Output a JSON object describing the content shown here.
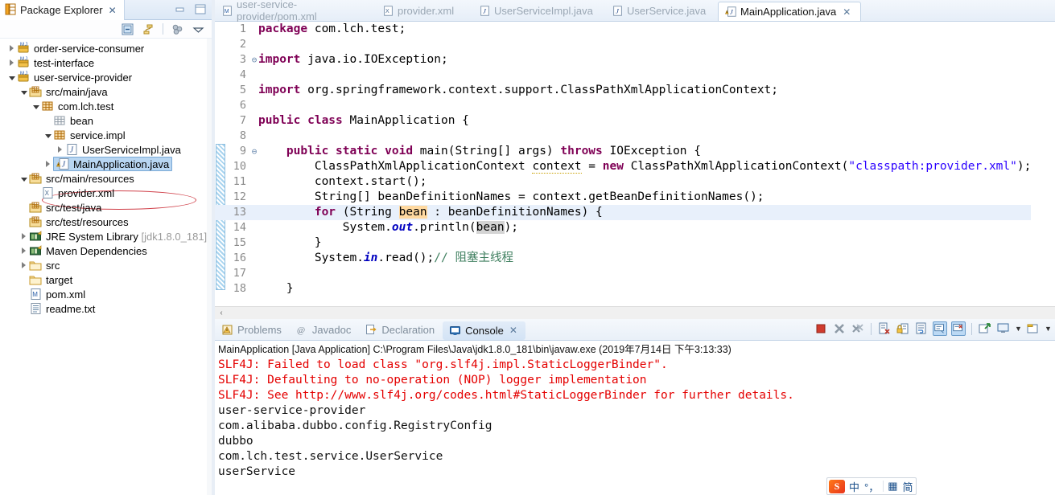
{
  "package_explorer": {
    "tab_title": "Package Explorer",
    "tab_close": "✕",
    "toolbar_icons": [
      "collapse-all-icon",
      "link-with-editor-icon",
      "view-menu-icon",
      "view-dropdown-icon"
    ],
    "window_buttons": [
      "minimize-icon",
      "maximize-icon"
    ],
    "tree": [
      {
        "label": "order-service-consumer",
        "indent": 0,
        "arrow": "closed",
        "icon": "maven-project-icon"
      },
      {
        "label": "test-interface",
        "indent": 0,
        "arrow": "closed",
        "icon": "maven-project-icon"
      },
      {
        "label": "user-service-provider",
        "indent": 0,
        "arrow": "open",
        "icon": "maven-project-icon"
      },
      {
        "label": "src/main/java",
        "indent": 1,
        "arrow": "open",
        "icon": "source-folder-icon"
      },
      {
        "label": "com.lch.test",
        "indent": 2,
        "arrow": "open",
        "icon": "package-icon"
      },
      {
        "label": "bean",
        "indent": 3,
        "arrow": "none",
        "icon": "empty-package-icon"
      },
      {
        "label": "service.impl",
        "indent": 3,
        "arrow": "open",
        "icon": "package-icon"
      },
      {
        "label": "UserServiceImpl.java",
        "indent": 4,
        "arrow": "closed",
        "icon": "java-file-icon"
      },
      {
        "label": "MainApplication.java",
        "indent": 3,
        "arrow": "closed",
        "icon": "java-file-warning-icon",
        "selected": true
      },
      {
        "label": "src/main/resources",
        "indent": 1,
        "arrow": "open",
        "icon": "source-folder-icon"
      },
      {
        "label": "provider.xml",
        "indent": 2,
        "arrow": "none",
        "icon": "xml-file-icon"
      },
      {
        "label": "src/test/java",
        "indent": 1,
        "arrow": "none",
        "icon": "source-folder-icon"
      },
      {
        "label": "src/test/resources",
        "indent": 1,
        "arrow": "none",
        "icon": "source-folder-icon"
      },
      {
        "label": "JRE System Library ",
        "muted": "[jdk1.8.0_181]",
        "indent": 1,
        "arrow": "closed",
        "icon": "library-icon"
      },
      {
        "label": "Maven Dependencies",
        "indent": 1,
        "arrow": "closed",
        "icon": "library-icon"
      },
      {
        "label": "src",
        "indent": 1,
        "arrow": "closed",
        "icon": "folder-icon"
      },
      {
        "label": "target",
        "indent": 1,
        "arrow": "none",
        "icon": "folder-icon"
      },
      {
        "label": "pom.xml",
        "indent": 1,
        "arrow": "none",
        "icon": "pom-file-icon"
      },
      {
        "label": "readme.txt",
        "indent": 1,
        "arrow": "none",
        "icon": "text-file-icon"
      }
    ]
  },
  "editor": {
    "tabs": [
      {
        "label": "user-service-provider/pom.xml",
        "icon": "pom-file-icon",
        "active": false
      },
      {
        "label": "provider.xml",
        "icon": "xml-file-icon",
        "active": false
      },
      {
        "label": "UserServiceImpl.java",
        "icon": "java-file-icon",
        "active": false
      },
      {
        "label": "UserService.java",
        "icon": "java-file-icon",
        "active": false
      },
      {
        "label": "MainApplication.java",
        "icon": "java-file-warning-icon",
        "active": true,
        "close": "✕"
      }
    ],
    "code_lines": [
      {
        "n": "1",
        "fold": "",
        "highlight": false
      },
      {
        "n": "2",
        "fold": "",
        "highlight": false
      },
      {
        "n": "3",
        "fold": "⊖",
        "highlight": false
      },
      {
        "n": "4",
        "fold": "",
        "highlight": false
      },
      {
        "n": "5",
        "fold": "",
        "highlight": false
      },
      {
        "n": "6",
        "fold": "",
        "highlight": false
      },
      {
        "n": "7",
        "fold": "",
        "highlight": false
      },
      {
        "n": "8",
        "fold": "",
        "highlight": false
      },
      {
        "n": "9",
        "fold": "⊖",
        "highlight": false
      },
      {
        "n": "10",
        "fold": "",
        "highlight": false
      },
      {
        "n": "11",
        "fold": "",
        "highlight": false
      },
      {
        "n": "12",
        "fold": "",
        "highlight": false
      },
      {
        "n": "13",
        "fold": "",
        "highlight": true
      },
      {
        "n": "14",
        "fold": "",
        "highlight": false
      },
      {
        "n": "15",
        "fold": "",
        "highlight": false
      },
      {
        "n": "16",
        "fold": "",
        "highlight": false
      },
      {
        "n": "17",
        "fold": "",
        "highlight": false
      },
      {
        "n": "18",
        "fold": "",
        "highlight": false
      }
    ],
    "code_text": {
      "l1": "package com.lch.test;",
      "l3": "import java.io.IOException;",
      "l5": "import org.springframework.context.support.ClassPathXmlApplicationContext;",
      "l7": "public class MainApplication {",
      "l9": "    public static void main(String[] args) throws IOException {",
      "l10": "        ClassPathXmlApplicationContext context = new ClassPathXmlApplicationContext(\"classpath:provider.xml\");",
      "l11": "        context.start();",
      "l12": "        String[] beanDefinitionNames = context.getBeanDefinitionNames();",
      "l13": "        for (String bean : beanDefinitionNames) {",
      "l14": "            System.out.println(bean);",
      "l15": "        }",
      "l16": "        System.in.read();// 阻塞主线程",
      "l18": "    }",
      "string_literal": "\"classpath:provider.xml\"",
      "comment": "// 阻塞主线程"
    }
  },
  "console": {
    "tabs": [
      {
        "label": "Problems",
        "icon": "problems-icon",
        "active": false
      },
      {
        "label": "Javadoc",
        "icon": "javadoc-icon",
        "active": false
      },
      {
        "label": "Declaration",
        "icon": "declaration-icon",
        "active": false
      },
      {
        "label": "Console",
        "icon": "console-icon",
        "active": true,
        "close": "✕"
      }
    ],
    "toolbar": [
      "terminate-icon",
      "remove-launch-icon",
      "remove-all-terminated-icon",
      "clear-console-icon",
      "scroll-lock-icon",
      "word-wrap-icon",
      "show-console-on-output-icon",
      "show-console-on-error-icon",
      "pin-console-icon",
      "display-selected-console-icon",
      "display-console-dropdown-icon",
      "open-console-icon",
      "open-console-dropdown-icon"
    ],
    "launch_header": "MainApplication [Java Application] C:\\Program Files\\Java\\jdk1.8.0_181\\bin\\javaw.exe (2019年7月14日 下午3:13:33)",
    "output": [
      {
        "text": "SLF4J: Failed to load class \"org.slf4j.impl.StaticLoggerBinder\".",
        "stream": "err"
      },
      {
        "text": "SLF4J: Defaulting to no-operation (NOP) logger implementation",
        "stream": "err"
      },
      {
        "text": "SLF4J: See http://www.slf4j.org/codes.html#StaticLoggerBinder for further details.",
        "stream": "err"
      },
      {
        "text": "user-service-provider",
        "stream": "std"
      },
      {
        "text": "com.alibaba.dubbo.config.RegistryConfig",
        "stream": "std"
      },
      {
        "text": "dubbo",
        "stream": "std"
      },
      {
        "text": "com.lch.test.service.UserService",
        "stream": "std"
      },
      {
        "text": "userService",
        "stream": "std"
      }
    ]
  },
  "ime": {
    "logo": "S",
    "mode": "中",
    "punctuation": "°，",
    "keyboard": "▦",
    "simplified": "简"
  },
  "colors": {
    "keyword": "#7f0055",
    "string": "#2a00ff",
    "comment": "#3f7f5f",
    "console_error": "#e40000",
    "selection": "#b8d6f2",
    "annotation_red": "#d0414a"
  }
}
